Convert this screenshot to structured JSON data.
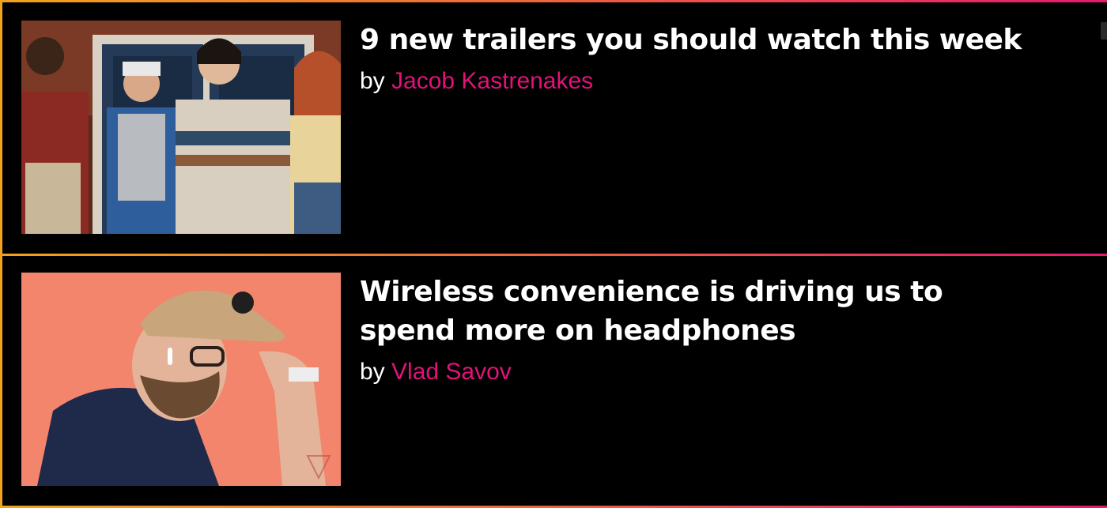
{
  "articles": [
    {
      "headline": "9 new trailers you should watch this week",
      "by": "by",
      "author": "Jacob Kastrenakes",
      "image_icon": "photo-group-of-kids"
    },
    {
      "headline": "Wireless convenience is driving us to spend more on headphones",
      "by": "by",
      "author": "Vlad Savov",
      "image_icon": "photo-man-with-cap-earbuds"
    }
  ],
  "colors": {
    "background": "#000000",
    "headline": "#ffffff",
    "author_link": "#e2127a",
    "border_start": "#f2a31a",
    "border_end": "#e6196e"
  }
}
